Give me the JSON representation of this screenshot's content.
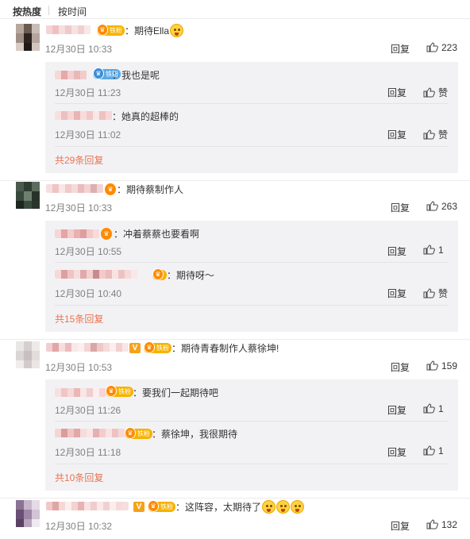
{
  "sort": {
    "hot": "按热度",
    "time": "按时间"
  },
  "labels": {
    "reply": "回复",
    "like_empty": "赞",
    "colon": "："
  },
  "colors": {
    "accent": "#eb7350",
    "badge_gold": "#f7b200",
    "badge_blue": "#5aa9e6",
    "sub_bg": "#f2f2f5"
  },
  "badge_text": "铁粉",
  "comments": [
    {
      "text": "期待Ella",
      "time": "12月30日 10:33",
      "likes": "223",
      "replies": [
        {
          "text": "我也是呢",
          "time": "12月30日 11:23",
          "likes": "赞"
        },
        {
          "text": "她真的超棒的",
          "time": "12月30日 11:02",
          "likes": "赞"
        }
      ],
      "more": "共29条回复"
    },
    {
      "text": "期待蔡制作人",
      "time": "12月30日 10:33",
      "likes": "263",
      "replies": [
        {
          "text": "冲着蔡蔡也要看啊",
          "time": "12月30日 10:55",
          "likes": "1"
        },
        {
          "text": "期待呀～",
          "time": "12月30日 10:40",
          "likes": "赞"
        }
      ],
      "more": "共15条回复"
    },
    {
      "text": "期待青春制作人蔡徐坤!",
      "time": "12月30日 10:53",
      "likes": "159",
      "replies": [
        {
          "text": "要我们一起期待吧",
          "time": "12月30日 11:26",
          "likes": "1"
        },
        {
          "text": "蔡徐坤，我很期待",
          "time": "12月30日 11:18",
          "likes": "1"
        }
      ],
      "more": "共10条回复"
    },
    {
      "text": "这阵容，太期待了",
      "time": "12月30日 10:32",
      "likes": "132",
      "replies": [],
      "more": ""
    }
  ]
}
